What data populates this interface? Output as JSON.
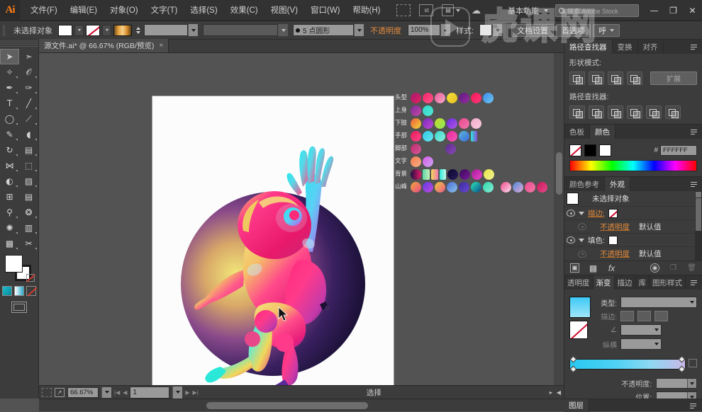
{
  "app": {
    "logo": "Ai",
    "title": "Adobe Illustrator"
  },
  "menu": {
    "items": [
      {
        "label": "文件(F)",
        "name": "menu-file"
      },
      {
        "label": "编辑(E)",
        "name": "menu-edit"
      },
      {
        "label": "对象(O)",
        "name": "menu-object"
      },
      {
        "label": "文字(T)",
        "name": "menu-type"
      },
      {
        "label": "选择(S)",
        "name": "menu-select"
      },
      {
        "label": "效果(C)",
        "name": "menu-effect"
      },
      {
        "label": "视图(V)",
        "name": "menu-view"
      },
      {
        "label": "窗口(W)",
        "name": "menu-window"
      },
      {
        "label": "帮助(H)",
        "name": "menu-help"
      }
    ]
  },
  "titlebar": {
    "bridge_icon": "br-icon",
    "stock_icon": "st-icon",
    "arrange_icon": "arrange-documents-icon",
    "arrange_caret": "▾",
    "cc_icon": "creative-cloud-icon",
    "workspace": "基本功能",
    "workspace_caret": "▾",
    "search_placeholder": "搜索 Adobe Stock",
    "minimize": "—",
    "maximize": "❐",
    "close": "✕"
  },
  "controlbar": {
    "selection_label": "未选择对象",
    "fill_caret": "▾",
    "stroke_caret": "▾",
    "stroke_weight_value": "",
    "stroke_weight_caret": "▾",
    "stroke_profile_value": "",
    "stroke_profile_caret": "▾",
    "brush_value": "5 点圆形",
    "brush_caret": "▾",
    "opacity_label": "不透明度",
    "opacity_value": "100%",
    "opacity_caret": "▸",
    "style_label": "样式:",
    "style_caret": "▾",
    "doc_setup_button": "文档设置",
    "preferences_button": "首选项",
    "extra_button": "呼",
    "extra_caret": "▾"
  },
  "document_tab": {
    "title": "源文件.ai* @ 66.67% (RGB/预览)",
    "close": "×"
  },
  "toolbar": {
    "tools": [
      {
        "name": "selection-tool",
        "glyph": "➤",
        "active": true
      },
      {
        "name": "direct-selection-tool",
        "glyph": "➢",
        "active": false
      },
      {
        "name": "magic-wand-tool",
        "glyph": "✧",
        "active": false
      },
      {
        "name": "lasso-tool",
        "glyph": "◠",
        "active": false
      },
      {
        "name": "pen-tool",
        "glyph": "✒",
        "active": false
      },
      {
        "name": "curvature-tool",
        "glyph": "✑",
        "active": false
      },
      {
        "name": "type-tool",
        "glyph": "T",
        "active": false
      },
      {
        "name": "line-segment-tool",
        "glyph": "╱",
        "active": false
      },
      {
        "name": "ellipse-tool",
        "glyph": "◯",
        "active": false
      },
      {
        "name": "paintbrush-tool",
        "glyph": "🖌",
        "active": false
      },
      {
        "name": "shaper-tool",
        "glyph": "✎",
        "active": false
      },
      {
        "name": "eraser-tool",
        "glyph": "◨",
        "active": false
      },
      {
        "name": "rotate-tool",
        "glyph": "↻",
        "active": false
      },
      {
        "name": "scale-tool",
        "glyph": "⧉",
        "active": false
      },
      {
        "name": "width-tool",
        "glyph": "⋈",
        "active": false
      },
      {
        "name": "free-transform-tool",
        "glyph": "⬚",
        "active": false
      },
      {
        "name": "shape-builder-tool",
        "glyph": "⬤",
        "active": false
      },
      {
        "name": "perspective-grid-tool",
        "glyph": "▦",
        "active": false
      },
      {
        "name": "mesh-tool",
        "glyph": "⊞",
        "active": false
      },
      {
        "name": "gradient-tool",
        "glyph": "▤",
        "active": false
      },
      {
        "name": "eyedropper-tool",
        "glyph": "⚲",
        "active": false
      },
      {
        "name": "blend-tool",
        "glyph": "❂",
        "active": false
      },
      {
        "name": "symbol-sprayer-tool",
        "glyph": "✺",
        "active": false
      },
      {
        "name": "column-graph-tool",
        "glyph": "▥",
        "active": false
      },
      {
        "name": "artboard-tool",
        "glyph": "▩",
        "active": false
      },
      {
        "name": "slice-tool",
        "glyph": "✂",
        "active": false
      }
    ],
    "fill_color": "#ffffff",
    "stroke_color": "#ffffff"
  },
  "canvas": {
    "artboard_bg": "#fcfcfc",
    "artwork_name": "astronaut-gradient-illustration",
    "swatch_rows": [
      {
        "label": "头型",
        "colors": [
          "#a11a6e|#e81f62",
          "#f0206a|#ff5a8a",
          "#e85a9a|#f7a8c8",
          "#f2e03a|#e8c020",
          "#5b1a7a|#9a2aa8",
          "#f0185a|#ff3a7a",
          "#3a8ae8|#6ec8f5"
        ]
      },
      {
        "label": "上身",
        "colors": [
          "#7a2a9a|#c84aa8",
          "#2ad8c8|#58e8d8"
        ]
      },
      {
        "label": "下肢",
        "colors": [
          "#f05a3a|#f0d83a",
          "#7a2ab8|#c04ad8",
          "#c8d82a|#8ae85a",
          "#6a2ad8|#b05ae8",
          "#e8488a|#f078b0",
          "#f0a8c8|#f8d0e0"
        ]
      },
      {
        "label": "手部",
        "colors": [
          "#e8185a|#ff4a8a",
          "#2ac8e8|#6ae8f0",
          "#3ad8c8|#8af0e0",
          "#e8289a|#f858b8",
          "#5ab8d8|#3a6ad8",
          "#2ae8d8|#8a4ad8"
        ]
      },
      {
        "label": "脚部",
        "colors": [
          "#b82a6a|#d85a9a",
          "#5a2a8a|#8a4ab8"
        ]
      },
      {
        "label": "文字",
        "colors": [
          "#f07a4a|#f8b08a",
          "#d85ae8|#c8a8f0"
        ]
      },
      {
        "label": "背景",
        "colors": [
          "#1a1040|#e8186a",
          "#5ad8a8|#c8f0b8",
          "#f0d85a|#f078b0",
          "#2ae8d8|#c8f8f0",
          "#0a0830|#2a1a5a",
          "#3a0a5a|#7a1a9a",
          "#a81a9a|#e848c8",
          "#e8e84a|#f0f090"
        ]
      },
      {
        "label": "山峰",
        "colors": [
          "#f0a83a|#e8488a",
          "#5a3ae8|#c84ad8",
          "#e8c83a|#f05a8a",
          "#4a6ad8|#8ac8e8",
          "#3a2a9a|#6a4ad8",
          "#2ae8b8|#0a4a8a",
          "#2ad8a8|#8aecd8",
          "#f0488a|#f8e0f0",
          "#4a8ad8|#e8a8d8",
          "#e8488a|#f87aaa",
          "#c8185a|#e84a8a"
        ]
      }
    ]
  },
  "panels": {
    "pathfinder": {
      "tabs": [
        {
          "label": "路径查找器",
          "active": true
        },
        {
          "label": "变换",
          "active": false
        },
        {
          "label": "对齐",
          "active": false
        }
      ],
      "shape_modes_label": "形状模式:",
      "pathfinder_label": "路径查找器:",
      "expand_button": "扩展"
    },
    "color": {
      "tabs": [
        {
          "label": "色板",
          "active": false
        },
        {
          "label": "颜色",
          "active": true
        }
      ],
      "hash": "#",
      "hex_value": "FFFFFF"
    },
    "appearance": {
      "tabs": [
        {
          "label": "颜色参考",
          "active": false
        },
        {
          "label": "外观",
          "active": true
        }
      ],
      "target_label": "未选择对象",
      "rows": [
        {
          "name": "描边:",
          "value": "",
          "type": "stroke"
        },
        {
          "name": "不透明度",
          "value": "默认值",
          "type": "opacity"
        },
        {
          "name": "填色:",
          "value": "",
          "type": "fill"
        },
        {
          "name": "不透明度",
          "value": "默认值",
          "type": "opacity"
        }
      ]
    },
    "gradient": {
      "tabs": [
        {
          "label": "透明度",
          "active": false
        },
        {
          "label": "渐变",
          "active": true
        },
        {
          "label": "描边",
          "active": false
        },
        {
          "label": "库",
          "active": false
        },
        {
          "label": "图形样式",
          "active": false
        }
      ],
      "type_label": "类型:",
      "type_value": "",
      "stroke_label": "描边:",
      "angle_label": "∠",
      "angle_value": "",
      "ratio_label": "纵横",
      "ratio_value": "",
      "opacity_label": "不透明度:",
      "opacity_value": "",
      "position_label": "位置:",
      "position_value": ""
    },
    "layers": {
      "tab": "图层"
    }
  },
  "statusbar": {
    "zoom_value": "66.67%",
    "zoom_caret": "▾",
    "artboard_nav_first": "|◀",
    "artboard_nav_prev": "◀",
    "artboard_value": "1",
    "artboard_caret": "▾",
    "artboard_nav_next": "▶",
    "artboard_nav_last": "▶|",
    "status_text": "选择",
    "right_arrow": "▸",
    "left_arrow": "◀"
  },
  "watermark": {
    "text": "虎课网"
  }
}
